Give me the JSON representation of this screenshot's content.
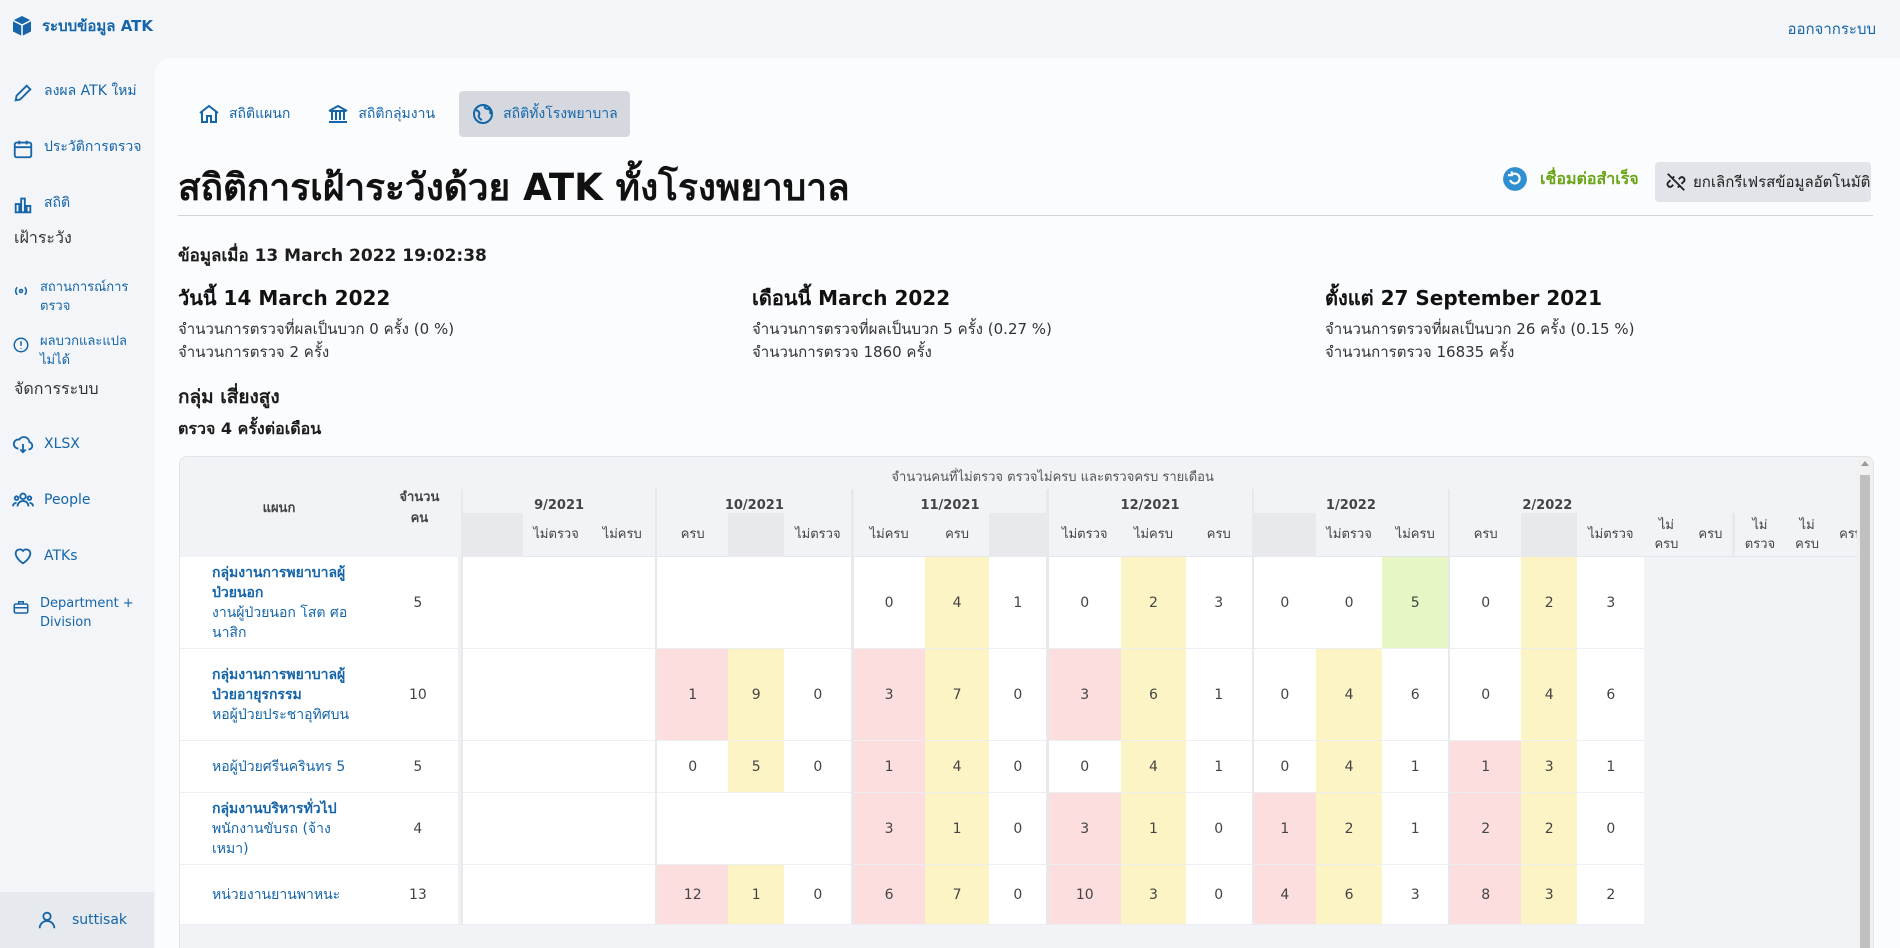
{
  "app": {
    "title": "ระบบข้อมูล ATK",
    "logout_label": "ออกจากระบบ",
    "accent": "#1565a8"
  },
  "sidebar": {
    "items": [
      {
        "label": "ลงผล ATK ใหม่",
        "icon": "pencil-icon"
      },
      {
        "label": "ประวัติการตรวจ",
        "icon": "calendar-icon"
      },
      {
        "label": "สถิติ",
        "icon": "bar-chart-icon"
      },
      {
        "label": "สถานการณ์การตรวจ",
        "icon": "broadcast-icon"
      },
      {
        "label": "ผลบวกและแปลไม่ได้",
        "icon": "alert-circle-icon"
      },
      {
        "label": "XLSX",
        "icon": "cloud-download-icon"
      },
      {
        "label": "People",
        "icon": "people-icon"
      },
      {
        "label": "ATKs",
        "icon": "heart-icon"
      },
      {
        "label": "Department + Division",
        "icon": "briefcase-icon"
      }
    ],
    "section_watch": "เฝ้าระวัง",
    "section_admin": "จัดการระบบ",
    "user": "suttisak"
  },
  "tabs": [
    {
      "label": "สถิติแผนก",
      "icon": "home-icon",
      "active": false
    },
    {
      "label": "สถิติกลุ่มงาน",
      "icon": "bank-icon",
      "active": false
    },
    {
      "label": "สถิติทั้งโรงพยาบาล",
      "icon": "globe-icon",
      "active": true
    }
  ],
  "page": {
    "title": "สถิติการเฝ้าระวังด้วย ATK ทั้งโรงพยาบาล",
    "connection_status": "เชื่อมต่อสำเร็จ",
    "connection_color": "#6aa516",
    "refresh_button": "ยกเลิกรีเฟรสข้อมูลอัตโนมัติ",
    "as_of": "ข้อมูลเมื่อ 13 March 2022 19:02:38"
  },
  "stats": [
    {
      "heading": "วันนี้ 14 March 2022",
      "positive": "จำนวนการตรวจที่ผลเป็นบวก 0 ครั้ง (0 %)",
      "total": "จำนวนการตรวจ 2 ครั้ง"
    },
    {
      "heading": "เดือนนี้ March 2022",
      "positive": "จำนวนการตรวจที่ผลเป็นบวก 5 ครั้ง (0.27 %)",
      "total": "จำนวนการตรวจ 1860 ครั้ง"
    },
    {
      "heading": "ตั้งแต่ 27 September 2021",
      "positive": "จำนวนการตรวจที่ผลเป็นบวก 26 ครั้ง (0.15 %)",
      "total": "จำนวนการตรวจ 16835 ครั้ง"
    }
  ],
  "group": {
    "title": "กลุ่ม เสี่ยงสูง",
    "subtitle": "ตรวจ 4 ครั้งต่อเดือน"
  },
  "table": {
    "super_header": "จำนวนคนที่ไม่ตรวจ ตรวจไม่ครบ และตรวจครบ รายเดือน",
    "col_dept": "แผนก",
    "col_count": "จำนวนคน",
    "sub_cols": [
      "ไม่ตรวจ",
      "ไม่ครบ",
      "ครบ"
    ],
    "months": [
      "9/2021",
      "10/2021",
      "11/2021",
      "12/2021",
      "1/2022",
      "2/2022"
    ],
    "row_colors": {
      "r": "#fddede",
      "y": "#fdf4c6",
      "g": "#e6f7c5"
    },
    "rows": [
      {
        "dept": "กลุ่มงานการพยาบาลผู้ป่วยนอก",
        "division": "งานผู้ป่วยนอก โสต ศอ นาสิก",
        "count": "5",
        "cells": [
          [
            "",
            "",
            ""
          ],
          [
            "",
            "",
            ""
          ],
          [
            "0",
            "4",
            "1"
          ],
          [
            "0",
            "2",
            "3"
          ],
          [
            "0",
            "0",
            "5"
          ],
          [
            "0",
            "2",
            "3"
          ]
        ],
        "colors": [
          [
            "",
            "",
            ""
          ],
          [
            "",
            "",
            ""
          ],
          [
            "",
            "y",
            ""
          ],
          [
            "",
            "y",
            ""
          ],
          [
            "",
            "",
            "g"
          ],
          [
            "",
            "y",
            ""
          ]
        ]
      },
      {
        "dept": "กลุ่มงานการพยาบาลผู้ป่วยอายุรกรรม",
        "division": "หอผู้ป่วยประชาอุทิศบน",
        "count": "10",
        "cells": [
          [
            "",
            "",
            ""
          ],
          [
            "1",
            "9",
            "0"
          ],
          [
            "3",
            "7",
            "0"
          ],
          [
            "3",
            "6",
            "1"
          ],
          [
            "0",
            "4",
            "6"
          ],
          [
            "0",
            "4",
            "6"
          ]
        ],
        "colors": [
          [
            "",
            "",
            ""
          ],
          [
            "r",
            "y",
            ""
          ],
          [
            "r",
            "y",
            ""
          ],
          [
            "r",
            "y",
            ""
          ],
          [
            "",
            "y",
            ""
          ],
          [
            "",
            "y",
            ""
          ]
        ]
      },
      {
        "dept": "",
        "division": "หอผู้ป่วยศรีนครินทร 5",
        "count": "5",
        "cells": [
          [
            "",
            "",
            ""
          ],
          [
            "0",
            "5",
            "0"
          ],
          [
            "1",
            "4",
            "0"
          ],
          [
            "0",
            "4",
            "1"
          ],
          [
            "0",
            "4",
            "1"
          ],
          [
            "1",
            "3",
            "1"
          ]
        ],
        "colors": [
          [
            "",
            "",
            ""
          ],
          [
            "",
            "y",
            ""
          ],
          [
            "r",
            "y",
            ""
          ],
          [
            "",
            "y",
            ""
          ],
          [
            "",
            "y",
            ""
          ],
          [
            "r",
            "y",
            ""
          ]
        ]
      },
      {
        "dept": "กลุ่มงานบริหารทั่วไป",
        "division": "พนักงานขับรถ (จ้างเหมา)",
        "count": "4",
        "cells": [
          [
            "",
            "",
            ""
          ],
          [
            "",
            "",
            ""
          ],
          [
            "3",
            "1",
            "0"
          ],
          [
            "3",
            "1",
            "0"
          ],
          [
            "1",
            "2",
            "1"
          ],
          [
            "2",
            "2",
            "0"
          ]
        ],
        "colors": [
          [
            "",
            "",
            ""
          ],
          [
            "",
            "",
            ""
          ],
          [
            "r",
            "y",
            ""
          ],
          [
            "r",
            "y",
            ""
          ],
          [
            "r",
            "y",
            ""
          ],
          [
            "r",
            "y",
            ""
          ]
        ]
      },
      {
        "dept": "",
        "division": "หน่วยงานยานพาหนะ",
        "count": "13",
        "cells": [
          [
            "",
            "",
            ""
          ],
          [
            "12",
            "1",
            "0"
          ],
          [
            "6",
            "7",
            "0"
          ],
          [
            "10",
            "3",
            "0"
          ],
          [
            "4",
            "6",
            "3"
          ],
          [
            "8",
            "3",
            "2"
          ]
        ],
        "colors": [
          [
            "",
            "",
            ""
          ],
          [
            "r",
            "y",
            ""
          ],
          [
            "r",
            "y",
            ""
          ],
          [
            "r",
            "y",
            ""
          ],
          [
            "r",
            "y",
            ""
          ],
          [
            "r",
            "y",
            ""
          ]
        ]
      }
    ]
  }
}
